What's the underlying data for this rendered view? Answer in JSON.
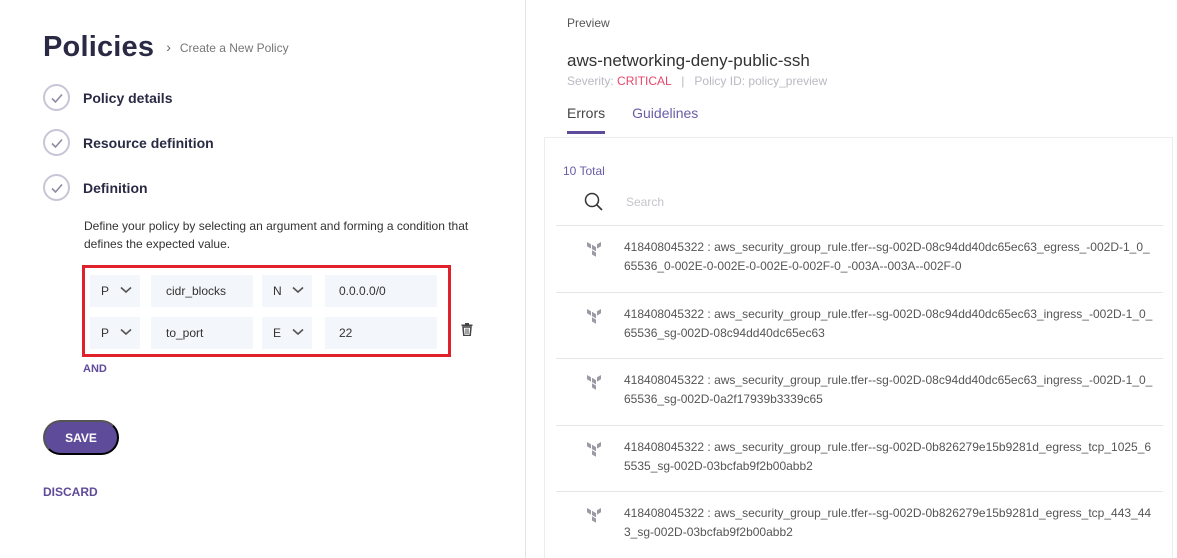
{
  "header": {
    "title": "Policies",
    "breadcrumb_separator": "›",
    "breadcrumb": "Create a New Policy"
  },
  "steps": [
    {
      "label": "Policy details"
    },
    {
      "label": "Resource definition"
    },
    {
      "label": "Definition"
    }
  ],
  "definition": {
    "description": "Define your policy by selecting an argument and forming a condition that defines the expected value.",
    "conditions": [
      {
        "operator": "P",
        "argument": "cidr_blocks",
        "comparator": "N",
        "value": "0.0.0.0/0"
      },
      {
        "operator": "P",
        "argument": "to_port",
        "comparator": "E",
        "value": "22"
      }
    ],
    "and_label": "AND"
  },
  "actions": {
    "save_label": "SAVE",
    "discard_label": "DISCARD"
  },
  "preview": {
    "label": "Preview",
    "policy_name": "aws-networking-deny-public-ssh",
    "severity_label": "Severity:",
    "severity_value": "CRITICAL",
    "meta_separator": "|",
    "policy_id_label": "Policy ID: policy_preview",
    "tabs": [
      {
        "label": "Errors",
        "active": true
      },
      {
        "label": "Guidelines",
        "active": false
      }
    ],
    "total": "10 Total",
    "search_placeholder": "Search",
    "errors": [
      "418408045322 : aws_security_group_rule.tfer--sg-002D-08c94dd40dc65ec63_egress_-002D-1_0_65536_0-002E-0-002E-0-002E-0-002F-0_-003A--003A--002F-0",
      "418408045322 : aws_security_group_rule.tfer--sg-002D-08c94dd40dc65ec63_ingress_-002D-1_0_65536_sg-002D-08c94dd40dc65ec63",
      "418408045322 : aws_security_group_rule.tfer--sg-002D-08c94dd40dc65ec63_ingress_-002D-1_0_65536_sg-002D-0a2f17939b3339c65",
      "418408045322 : aws_security_group_rule.tfer--sg-002D-0b826279e15b9281d_egress_tcp_1025_65535_sg-002D-03bcfab9f2b00abb2",
      "418408045322 : aws_security_group_rule.tfer--sg-002D-0b826279e15b9281d_egress_tcp_443_443_sg-002D-03bcfab9f2b00abb2"
    ]
  },
  "colors": {
    "accent": "#5e4b9a",
    "critical": "#e8476a",
    "highlight_box": "#e0202a"
  },
  "icons": {
    "step_status": "check-circle-icon",
    "dropdown": "chevron-down-icon",
    "delete": "trash-icon",
    "search": "search-icon",
    "resource": "terraform-icon"
  }
}
